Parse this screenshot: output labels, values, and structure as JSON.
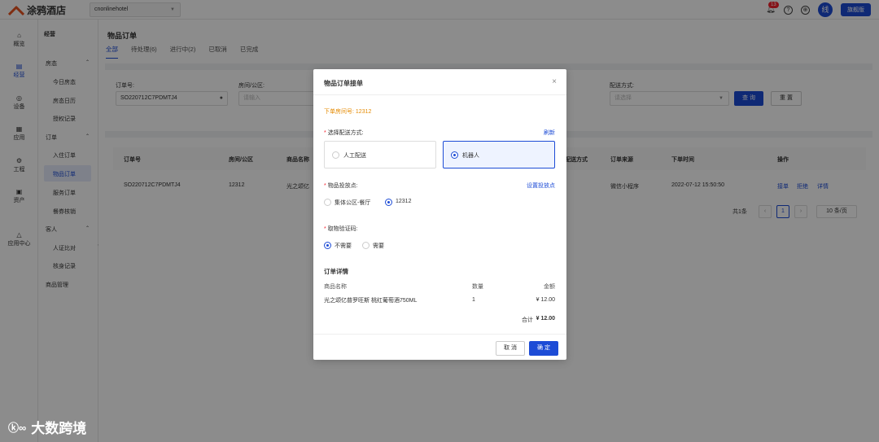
{
  "topbar": {
    "brand": "涂鸦酒店",
    "hotel": "cnonlinehotel",
    "bell_count": "13",
    "avatar": "线",
    "edition": "旗舰版"
  },
  "rail": {
    "items": [
      {
        "label": "概览",
        "icon": "home-icon"
      },
      {
        "label": "经营",
        "icon": "document-icon"
      },
      {
        "label": "设备",
        "icon": "device-icon"
      },
      {
        "label": "应用",
        "icon": "grid-icon"
      },
      {
        "label": "工程",
        "icon": "engineering-icon"
      },
      {
        "label": "资产",
        "icon": "asset-icon"
      },
      {
        "label": "应用中心",
        "icon": "app-center-icon"
      }
    ]
  },
  "submenu": {
    "header": "经营",
    "group_room": "房态",
    "room_items": [
      "今日房态",
      "房态日历",
      "授权记录"
    ],
    "group_order": "订单",
    "order_items": [
      "入住订单",
      "物品订单",
      "服务订单",
      "餐券核销"
    ],
    "group_guest": "客人",
    "guest_items": [
      "人证比对",
      "核身记录"
    ],
    "goods": "商品管理"
  },
  "main": {
    "title": "物品订单",
    "tabs": [
      "全部",
      "待处理(6)",
      "进行中(2)",
      "已取消",
      "已完成"
    ]
  },
  "filter": {
    "order_no_label": "订单号:",
    "order_no_value": "SO220712C7PDMTJ4",
    "room_label": "房间/公区:",
    "room_placeholder": "请输入",
    "delivery_label": "配送方式:",
    "delivery_placeholder": "请选择",
    "query": "查 询",
    "reset": "重 置"
  },
  "table": {
    "headers": [
      "订单号",
      "房间/公区",
      "商品名称",
      "配送方式",
      "订单来源",
      "下单时间",
      "操作"
    ],
    "row": {
      "order_no": "SO220712C7PDMTJ4",
      "room": "12312",
      "goods": "光之颂亿",
      "source": "微信小程序",
      "time": "2022-07-12 15:50:50",
      "actions": [
        "接单",
        "拒绝",
        "详情"
      ]
    },
    "pager": {
      "total": "共1条",
      "page": "1",
      "size": "10 条/页"
    }
  },
  "modal": {
    "title": "物品订单接单",
    "room_prefix": "下单房间号:",
    "room_no": "12312",
    "delivery_label": "选择配送方式:",
    "refresh": "刷新",
    "delivery_options": [
      "人工配送",
      "机器人"
    ],
    "drop_label": "物品投放点:",
    "drop_link": "设置投放点",
    "drop_options": [
      "集体公区-餐厅",
      "12312"
    ],
    "code_label": "取物验证码:",
    "code_options": [
      "不需要",
      "需要"
    ],
    "detail_title": "订单详情",
    "detail_headers": [
      "商品名称",
      "数量",
      "金额"
    ],
    "detail_row": {
      "name": "光之颂亿普罗旺斯 桃红葡萄酒750ML",
      "qty": "1",
      "amount": "¥ 12.00"
    },
    "total_label": "合计",
    "total_value": "¥ 12.00",
    "cancel": "取 消",
    "confirm": "确 定"
  },
  "watermark": "大数跨境",
  "colors": {
    "primary": "#1d4cd6",
    "warning": "#e58a00",
    "danger": "#f5222d"
  }
}
